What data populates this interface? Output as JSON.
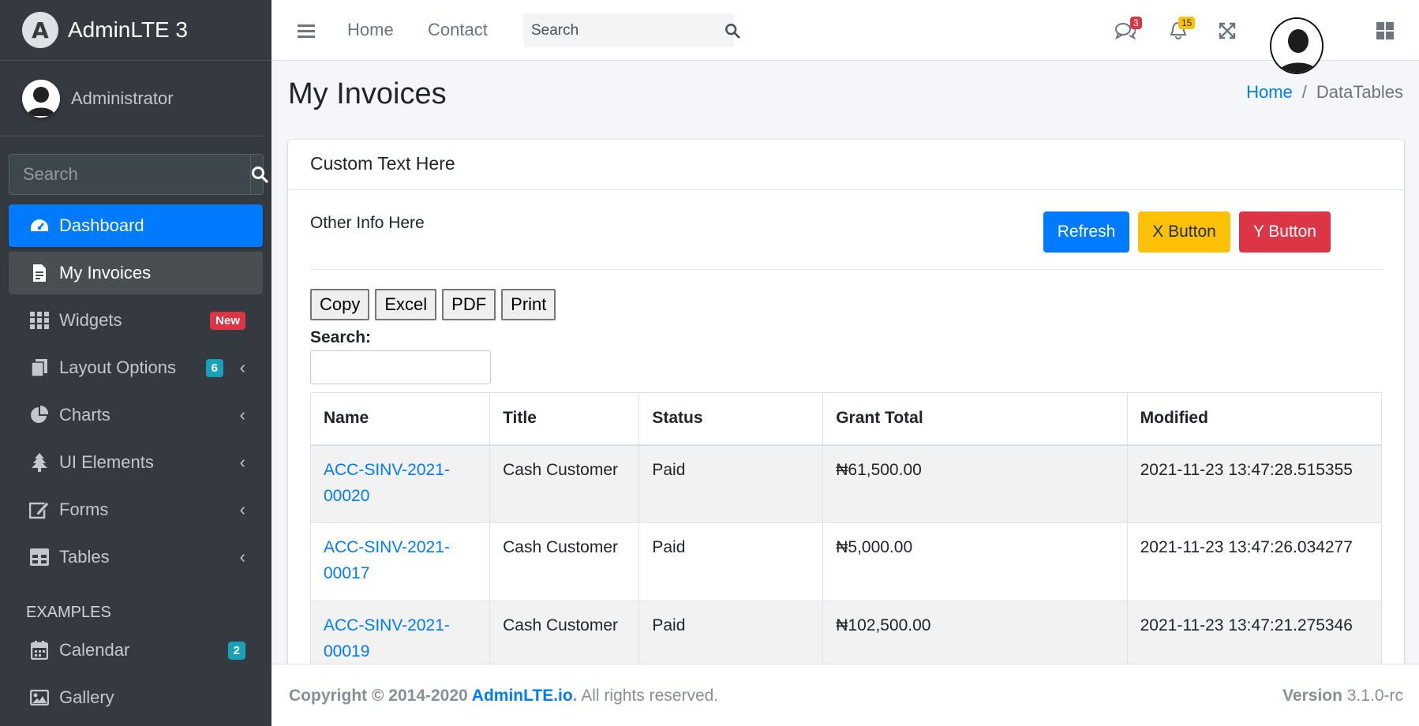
{
  "sidebar": {
    "brand": "AdminLTE 3",
    "brand_logo_letter": "A",
    "user_name": "Administrator",
    "search_placeholder": "Search",
    "items": [
      {
        "label": "Dashboard",
        "icon": "tachometer-icon",
        "state": "active"
      },
      {
        "label": "My Invoices",
        "icon": "file-invoice-icon",
        "state": "current"
      },
      {
        "label": "Widgets",
        "icon": "th-icon",
        "badge": "New",
        "badge_color": "#dc3545"
      },
      {
        "label": "Layout Options",
        "icon": "copy-icon",
        "badge": "6",
        "badge_color": "#17a2b8",
        "chevron": true
      },
      {
        "label": "Charts",
        "icon": "chart-pie-icon",
        "chevron": true
      },
      {
        "label": "UI Elements",
        "icon": "tree-icon",
        "chevron": true
      },
      {
        "label": "Forms",
        "icon": "edit-icon",
        "chevron": true
      },
      {
        "label": "Tables",
        "icon": "table-icon",
        "chevron": true
      }
    ],
    "examples_header": "EXAMPLES",
    "examples": [
      {
        "label": "Calendar",
        "icon": "calendar-icon",
        "badge": "2",
        "badge_color": "#17a2b8"
      },
      {
        "label": "Gallery",
        "icon": "image-icon"
      }
    ]
  },
  "navbar": {
    "links": [
      "Home",
      "Contact"
    ],
    "search_placeholder": "Search",
    "messages_count": "3",
    "notifications_count": "15"
  },
  "page": {
    "title": "My Invoices",
    "breadcrumb": {
      "home": "Home",
      "current": "DataTables"
    }
  },
  "card": {
    "header": "Custom Text Here",
    "other_info": "Other Info Here",
    "buttons": {
      "refresh": "Refresh",
      "x": "X Button",
      "y": "Y Button"
    }
  },
  "datatable": {
    "export_buttons": [
      "Copy",
      "Excel",
      "PDF",
      "Print"
    ],
    "search_label": "Search:",
    "columns": [
      "Name",
      "Title",
      "Status",
      "Grant Total",
      "Modified"
    ],
    "rows": [
      {
        "name_line1": "ACC-SINV-2021-",
        "name_line2": "00020",
        "title": "Cash Customer",
        "status": "Paid",
        "total": "₦61,500.00",
        "modified": "2021-11-23 13:47:28.515355"
      },
      {
        "name_line1": "ACC-SINV-2021-",
        "name_line2": "00017",
        "title": "Cash Customer",
        "status": "Paid",
        "total": "₦5,000.00",
        "modified": "2021-11-23 13:47:26.034277"
      },
      {
        "name_line1": "ACC-SINV-2021-",
        "name_line2": "00019",
        "title": "Cash Customer",
        "status": "Paid",
        "total": "₦102,500.00",
        "modified": "2021-11-23 13:47:21.275346"
      }
    ]
  },
  "footer": {
    "copyright_prefix": "Copyright © 2014-2020 ",
    "link": "AdminLTE.io",
    "suffix": ". All rights reserved.",
    "version_label": "Version",
    "version": "3.1.0-rc"
  },
  "colors": {
    "primary": "#007bff",
    "warning": "#ffc107",
    "danger": "#dc3545",
    "info": "#17a2b8",
    "sidebar": "#343a40"
  }
}
